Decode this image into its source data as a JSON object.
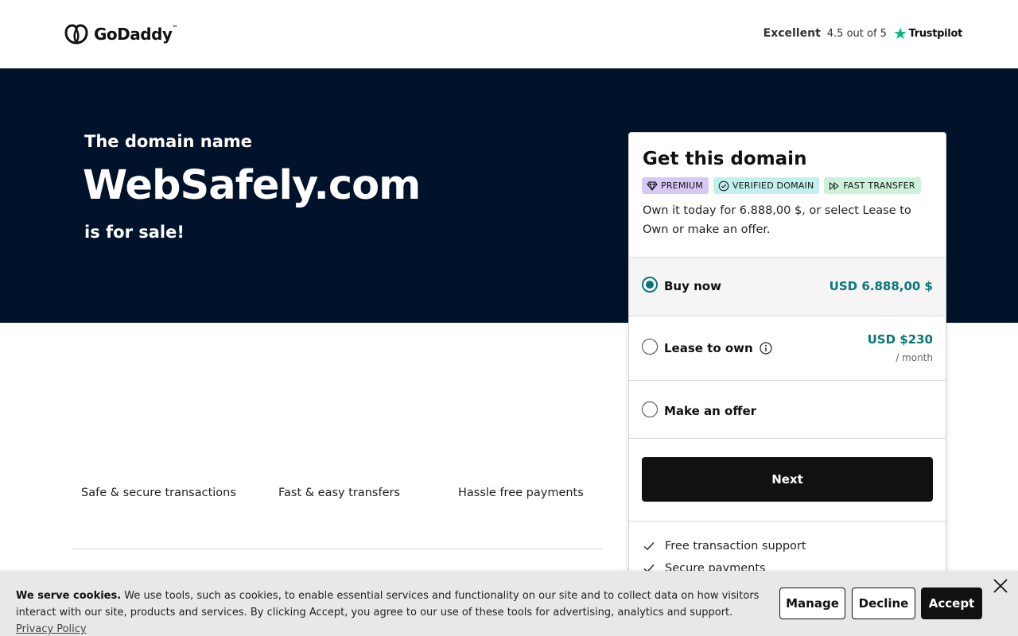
{
  "header": {
    "brand": "GoDaddy",
    "brand_tm": "™",
    "trustpilot": {
      "rating_word": "Excellent",
      "score_text": "4.5 out of 5",
      "logo_text": "Trustpilot"
    }
  },
  "hero": {
    "pre": "The domain name",
    "domain": "WebSafely.com",
    "post": "is for sale!"
  },
  "features": [
    "Safe & secure transactions",
    "Fast & easy transfers",
    "Hassle free payments"
  ],
  "card": {
    "title": "Get this domain",
    "badges": {
      "premium": "PREMIUM",
      "verified": "VERIFIED DOMAIN",
      "fast": "FAST TRANSFER"
    },
    "description": "Own it today for 6.888,00 $, or select Lease to Own or make an offer.",
    "options": {
      "buy": {
        "label": "Buy now",
        "price": "USD 6.888,00 $",
        "selected": true
      },
      "lease": {
        "label": "Lease to own",
        "price": "USD $230",
        "sub": "/ month",
        "selected": false
      },
      "offer": {
        "label": "Make an offer",
        "selected": false
      }
    },
    "next_label": "Next",
    "perks": [
      "Free transaction support",
      "Secure payments"
    ]
  },
  "cookie": {
    "title": "We serve cookies.",
    "body": " We use tools, such as cookies, to enable essential services and functionality on our site and to collect data on how visitors interact with our site, products and services. By clicking Accept, you agree to our use of these tools for advertising, analytics and support. ",
    "link": "Privacy Policy",
    "manage": "Manage",
    "decline": "Decline",
    "accept": "Accept"
  },
  "colors": {
    "hero_bg": "#00132b",
    "accent_teal": "#09757a",
    "trustpilot_green": "#00b67a"
  }
}
